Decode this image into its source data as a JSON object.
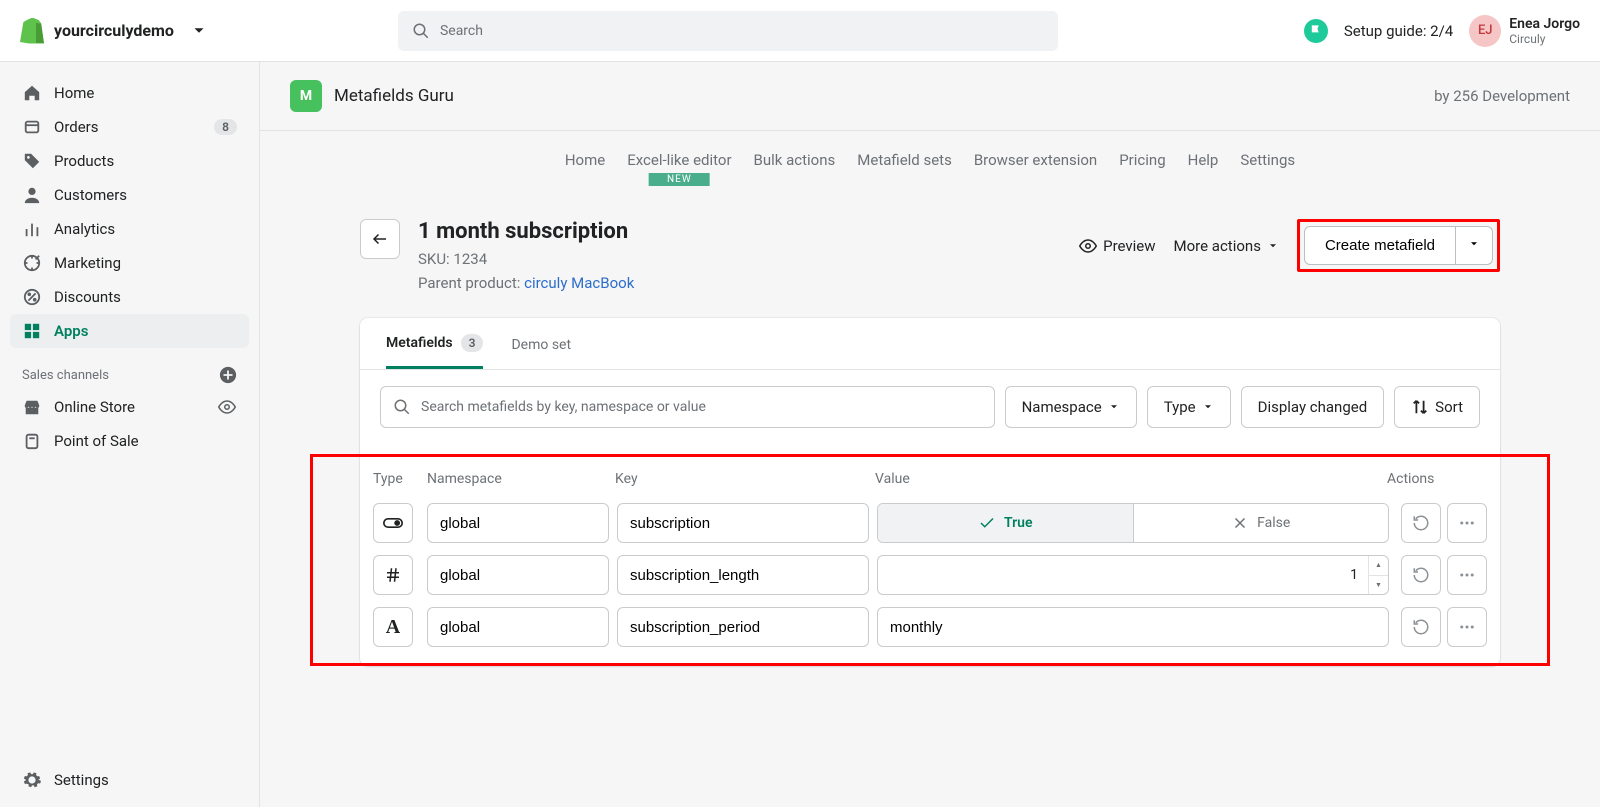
{
  "topbar": {
    "store_name": "yourcirculydemo",
    "search_placeholder": "Search",
    "setup_guide": "Setup guide: 2/4",
    "user_initials": "EJ",
    "user_name": "Enea Jorgo",
    "user_company": "Circuly"
  },
  "sidebar": {
    "items": [
      {
        "label": "Home"
      },
      {
        "label": "Orders",
        "badge": "8"
      },
      {
        "label": "Products"
      },
      {
        "label": "Customers"
      },
      {
        "label": "Analytics"
      },
      {
        "label": "Marketing"
      },
      {
        "label": "Discounts"
      },
      {
        "label": "Apps"
      }
    ],
    "section_label": "Sales channels",
    "channels": [
      {
        "label": "Online Store"
      },
      {
        "label": "Point of Sale"
      }
    ],
    "settings_label": "Settings"
  },
  "app": {
    "name": "Metafields Guru",
    "by": "by 256 Development",
    "tabs": [
      "Home",
      "Excel-like editor",
      "Bulk actions",
      "Metafield sets",
      "Browser extension",
      "Pricing",
      "Help",
      "Settings"
    ],
    "new_badge": "NEW"
  },
  "page": {
    "title": "1 month subscription",
    "sku_label": "SKU: 1234",
    "parent_label": "Parent product: ",
    "parent_link": "circuly MacBook",
    "preview": "Preview",
    "more_actions": "More actions",
    "create_btn": "Create metafield"
  },
  "card": {
    "tab_metafields": "Metafields",
    "tab_count": "3",
    "tab_demo": "Demo set",
    "search_placeholder": "Search metafields by key, namespace or value",
    "filter_namespace": "Namespace",
    "filter_type": "Type",
    "filter_display": "Display changed",
    "filter_sort": "Sort",
    "headers": {
      "type": "Type",
      "ns": "Namespace",
      "key": "Key",
      "val": "Value",
      "act": "Actions"
    },
    "bool_true": "True",
    "bool_false": "False",
    "rows": [
      {
        "type": "bool",
        "namespace": "global",
        "key": "subscription",
        "value": "true"
      },
      {
        "type": "number",
        "namespace": "global",
        "key": "subscription_length",
        "value": "1"
      },
      {
        "type": "text",
        "namespace": "global",
        "key": "subscription_period",
        "value": "monthly"
      }
    ]
  }
}
